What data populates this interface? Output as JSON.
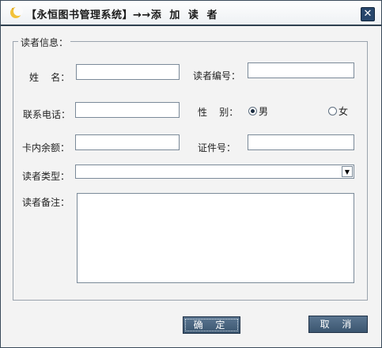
{
  "window": {
    "title": "【永恒图书管理系统】→→添  加  读  者",
    "close": "✕"
  },
  "form": {
    "group_title": "读者信息：",
    "name_label": "姓    名：",
    "reader_no_label": "读者编号：",
    "phone_label": "联系电话：",
    "gender_label": "性    别：",
    "gender_options": [
      {
        "label": "男",
        "checked": true
      },
      {
        "label": "女",
        "checked": false
      }
    ],
    "balance_label": "卡内余额：",
    "id_no_label": "证件号：",
    "type_label": "读者类型：",
    "type_value": "",
    "notes_label": "读者备注：",
    "name_value": "",
    "reader_no_value": "",
    "phone_value": "",
    "balance_value": "",
    "id_no_value": "",
    "notes_value": ""
  },
  "buttons": {
    "ok": "确 定",
    "cancel": "取 消"
  },
  "colors": {
    "titlebar_border": "#2f4050",
    "button": "#4a6580",
    "close": "#27466b"
  }
}
